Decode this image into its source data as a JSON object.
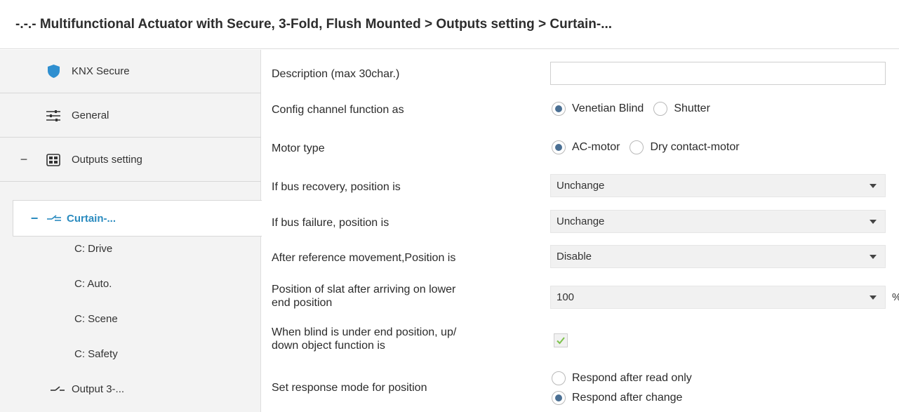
{
  "window": {
    "title": "-.-.- Multifunctional Actuator with Secure, 3-Fold, Flush Mounted > Outputs setting > Curtain-..."
  },
  "sidebar": {
    "items": [
      {
        "label": "KNX Secure",
        "icon": "shield-icon"
      },
      {
        "label": "General",
        "icon": "sliders-icon"
      },
      {
        "label": "Outputs setting",
        "icon": "module-icon",
        "expander": "−"
      },
      {
        "label": "Curtain-...",
        "icon": "curtain-icon",
        "expander": "−",
        "active": true
      },
      {
        "label": "C: Drive"
      },
      {
        "label": "C: Auto."
      },
      {
        "label": "C: Scene"
      },
      {
        "label": "C: Safety"
      },
      {
        "label": "Output 3-...",
        "icon": "switch-icon"
      }
    ]
  },
  "params": {
    "description": {
      "label": "Description (max 30char.)",
      "value": ""
    },
    "channel_function": {
      "label": "Config channel function as",
      "options": [
        "Venetian Blind",
        "Shutter"
      ],
      "selected": "Venetian Blind"
    },
    "motor_type": {
      "label": "Motor type",
      "options": [
        "AC-motor",
        "Dry contact-motor"
      ],
      "selected": "AC-motor"
    },
    "bus_recovery": {
      "label": "If bus recovery, position is",
      "value": "Unchange"
    },
    "bus_failure": {
      "label": "If bus failure, position is",
      "value": "Unchange"
    },
    "after_reference": {
      "label": "After reference movement,Position is",
      "value": "Disable"
    },
    "slat_position": {
      "label_line1": "Position of slat after arriving on lower",
      "label_line2": "end position",
      "value": "100",
      "unit": "%"
    },
    "under_end_position": {
      "label_line1": "When blind is under end position, up/",
      "label_line2": "down object function is",
      "checked": true
    },
    "response_mode": {
      "label": "Set response mode for position",
      "options": [
        "Respond after read only",
        "Respond after change"
      ],
      "selected": "Respond after change"
    }
  },
  "colors": {
    "accent": "#2a8bbf",
    "radio_dot": "#4a6f93",
    "check": "#7cc24b",
    "shield": "#2f8fd0"
  }
}
